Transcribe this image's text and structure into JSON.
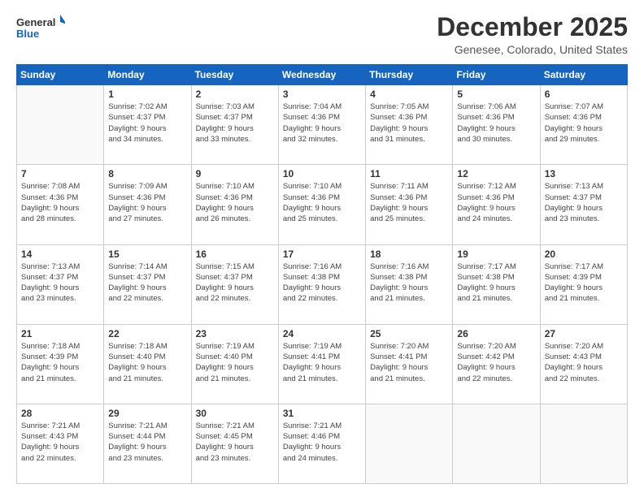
{
  "logo": {
    "line1": "General",
    "line2": "Blue"
  },
  "title": "December 2025",
  "location": "Genesee, Colorado, United States",
  "days_of_week": [
    "Sunday",
    "Monday",
    "Tuesday",
    "Wednesday",
    "Thursday",
    "Friday",
    "Saturday"
  ],
  "weeks": [
    [
      {
        "day": "",
        "info": ""
      },
      {
        "day": "1",
        "info": "Sunrise: 7:02 AM\nSunset: 4:37 PM\nDaylight: 9 hours\nand 34 minutes."
      },
      {
        "day": "2",
        "info": "Sunrise: 7:03 AM\nSunset: 4:37 PM\nDaylight: 9 hours\nand 33 minutes."
      },
      {
        "day": "3",
        "info": "Sunrise: 7:04 AM\nSunset: 4:36 PM\nDaylight: 9 hours\nand 32 minutes."
      },
      {
        "day": "4",
        "info": "Sunrise: 7:05 AM\nSunset: 4:36 PM\nDaylight: 9 hours\nand 31 minutes."
      },
      {
        "day": "5",
        "info": "Sunrise: 7:06 AM\nSunset: 4:36 PM\nDaylight: 9 hours\nand 30 minutes."
      },
      {
        "day": "6",
        "info": "Sunrise: 7:07 AM\nSunset: 4:36 PM\nDaylight: 9 hours\nand 29 minutes."
      }
    ],
    [
      {
        "day": "7",
        "info": "Sunrise: 7:08 AM\nSunset: 4:36 PM\nDaylight: 9 hours\nand 28 minutes."
      },
      {
        "day": "8",
        "info": "Sunrise: 7:09 AM\nSunset: 4:36 PM\nDaylight: 9 hours\nand 27 minutes."
      },
      {
        "day": "9",
        "info": "Sunrise: 7:10 AM\nSunset: 4:36 PM\nDaylight: 9 hours\nand 26 minutes."
      },
      {
        "day": "10",
        "info": "Sunrise: 7:10 AM\nSunset: 4:36 PM\nDaylight: 9 hours\nand 25 minutes."
      },
      {
        "day": "11",
        "info": "Sunrise: 7:11 AM\nSunset: 4:36 PM\nDaylight: 9 hours\nand 25 minutes."
      },
      {
        "day": "12",
        "info": "Sunrise: 7:12 AM\nSunset: 4:36 PM\nDaylight: 9 hours\nand 24 minutes."
      },
      {
        "day": "13",
        "info": "Sunrise: 7:13 AM\nSunset: 4:37 PM\nDaylight: 9 hours\nand 23 minutes."
      }
    ],
    [
      {
        "day": "14",
        "info": "Sunrise: 7:13 AM\nSunset: 4:37 PM\nDaylight: 9 hours\nand 23 minutes."
      },
      {
        "day": "15",
        "info": "Sunrise: 7:14 AM\nSunset: 4:37 PM\nDaylight: 9 hours\nand 22 minutes."
      },
      {
        "day": "16",
        "info": "Sunrise: 7:15 AM\nSunset: 4:37 PM\nDaylight: 9 hours\nand 22 minutes."
      },
      {
        "day": "17",
        "info": "Sunrise: 7:16 AM\nSunset: 4:38 PM\nDaylight: 9 hours\nand 22 minutes."
      },
      {
        "day": "18",
        "info": "Sunrise: 7:16 AM\nSunset: 4:38 PM\nDaylight: 9 hours\nand 21 minutes."
      },
      {
        "day": "19",
        "info": "Sunrise: 7:17 AM\nSunset: 4:38 PM\nDaylight: 9 hours\nand 21 minutes."
      },
      {
        "day": "20",
        "info": "Sunrise: 7:17 AM\nSunset: 4:39 PM\nDaylight: 9 hours\nand 21 minutes."
      }
    ],
    [
      {
        "day": "21",
        "info": "Sunrise: 7:18 AM\nSunset: 4:39 PM\nDaylight: 9 hours\nand 21 minutes."
      },
      {
        "day": "22",
        "info": "Sunrise: 7:18 AM\nSunset: 4:40 PM\nDaylight: 9 hours\nand 21 minutes."
      },
      {
        "day": "23",
        "info": "Sunrise: 7:19 AM\nSunset: 4:40 PM\nDaylight: 9 hours\nand 21 minutes."
      },
      {
        "day": "24",
        "info": "Sunrise: 7:19 AM\nSunset: 4:41 PM\nDaylight: 9 hours\nand 21 minutes."
      },
      {
        "day": "25",
        "info": "Sunrise: 7:20 AM\nSunset: 4:41 PM\nDaylight: 9 hours\nand 21 minutes."
      },
      {
        "day": "26",
        "info": "Sunrise: 7:20 AM\nSunset: 4:42 PM\nDaylight: 9 hours\nand 22 minutes."
      },
      {
        "day": "27",
        "info": "Sunrise: 7:20 AM\nSunset: 4:43 PM\nDaylight: 9 hours\nand 22 minutes."
      }
    ],
    [
      {
        "day": "28",
        "info": "Sunrise: 7:21 AM\nSunset: 4:43 PM\nDaylight: 9 hours\nand 22 minutes."
      },
      {
        "day": "29",
        "info": "Sunrise: 7:21 AM\nSunset: 4:44 PM\nDaylight: 9 hours\nand 23 minutes."
      },
      {
        "day": "30",
        "info": "Sunrise: 7:21 AM\nSunset: 4:45 PM\nDaylight: 9 hours\nand 23 minutes."
      },
      {
        "day": "31",
        "info": "Sunrise: 7:21 AM\nSunset: 4:46 PM\nDaylight: 9 hours\nand 24 minutes."
      },
      {
        "day": "",
        "info": ""
      },
      {
        "day": "",
        "info": ""
      },
      {
        "day": "",
        "info": ""
      }
    ]
  ]
}
